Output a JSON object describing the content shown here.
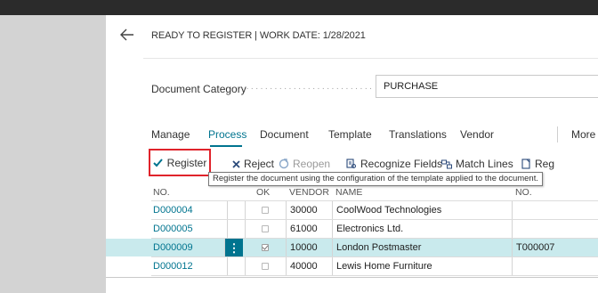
{
  "header": {
    "title": "READY TO REGISTER | WORK DATE: 1/28/2021"
  },
  "field": {
    "label": "Document Category",
    "dots": "·································",
    "value": "PURCHASE"
  },
  "tabs": [
    {
      "label": "Manage"
    },
    {
      "label": "Process"
    },
    {
      "label": "Document"
    },
    {
      "label": "Template"
    },
    {
      "label": "Translations"
    },
    {
      "label": "Vendor"
    },
    {
      "label": "More option"
    }
  ],
  "actions": {
    "register": "Register",
    "reject": "Reject",
    "reopen": "Reopen",
    "recognize": "Recognize Fields",
    "match": "Match Lines",
    "reg": "Reg"
  },
  "tooltip": "Register the document using the configuration of the template applied to the document.",
  "columns": {
    "no": "NO.",
    "ok": "OK",
    "vendor": "VENDOR",
    "name": "NAME",
    "no2": "NO."
  },
  "rows": [
    {
      "no": "D000004",
      "vendor": "30000",
      "name": "CoolWood Technologies",
      "no2": ""
    },
    {
      "no": "D000005",
      "vendor": "61000",
      "name": "Electronics Ltd.",
      "no2": ""
    },
    {
      "no": "D000009",
      "vendor": "10000",
      "name": "London Postmaster",
      "no2": "T000007"
    },
    {
      "no": "D000012",
      "vendor": "40000",
      "name": "Lewis Home Furniture",
      "no2": ""
    }
  ],
  "colors": {
    "accent": "#00748f",
    "highlight_border": "#e0232b",
    "selected_row": "#c9eaed"
  }
}
